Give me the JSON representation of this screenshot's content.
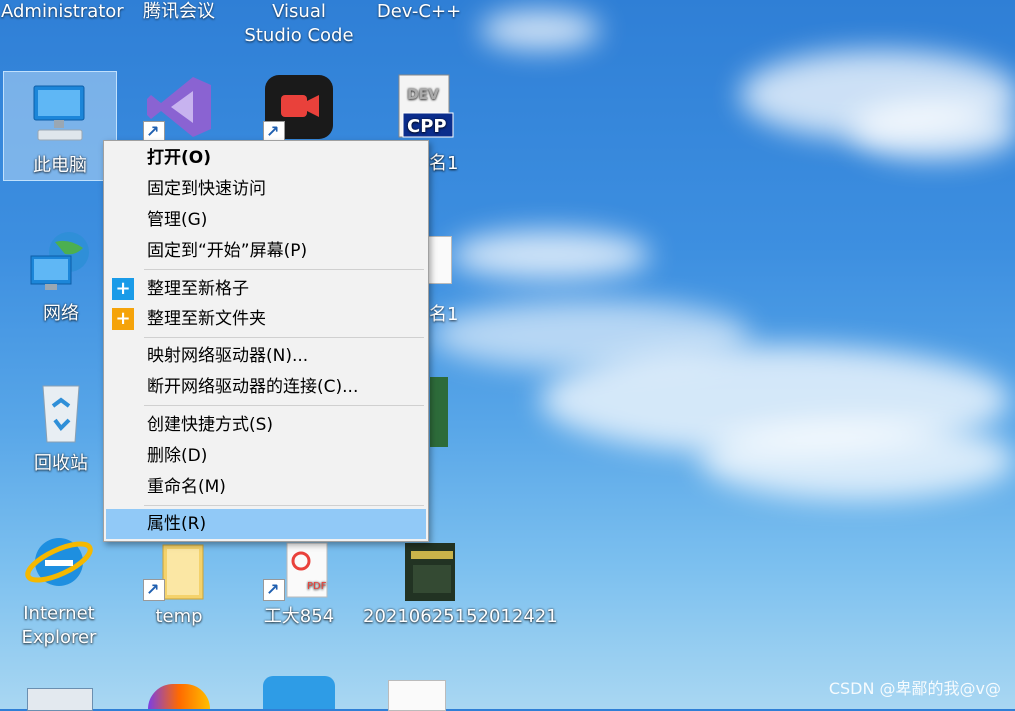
{
  "colors": {
    "menu_hover": "#91c9f7",
    "plus_blue": "#1a9be8",
    "plus_orange": "#f5a30a"
  },
  "top_labels": {
    "col1": "Administrator",
    "col2": "腾讯会议",
    "col3": "Visual Studio Code",
    "col4": "Dev-C++"
  },
  "icons": {
    "this_pc": "此电脑",
    "network": "网络",
    "recycle_bin": "回收站",
    "ie": "Internet Explorer",
    "temp": "temp",
    "gongda": "工大854",
    "file_2021": "20210625152012421",
    "cpp_partial": "名1",
    "file_partial2": "名1",
    "cpp_badge": "CPP",
    "dev_badge": "DEV",
    "pdf_badge": "PDF"
  },
  "context_menu": {
    "items": [
      {
        "label": "打开(O)",
        "bold": true
      },
      {
        "label": "固定到快速访问"
      },
      {
        "label": "管理(G)"
      },
      {
        "label": "固定到“开始”屏幕(P)"
      },
      {
        "label": "整理至新格子",
        "icon": "plus-blue"
      },
      {
        "label": "整理至新文件夹",
        "icon": "plus-orange"
      },
      {
        "label": "映射网络驱动器(N)..."
      },
      {
        "label": "断开网络驱动器的连接(C)..."
      },
      {
        "label": "创建快捷方式(S)"
      },
      {
        "label": "删除(D)"
      },
      {
        "label": "重命名(M)"
      },
      {
        "label": "属性(R)",
        "highlighted": true
      }
    ],
    "plus_symbol": "+"
  },
  "watermark": "CSDN @卑鄙的我@v@"
}
